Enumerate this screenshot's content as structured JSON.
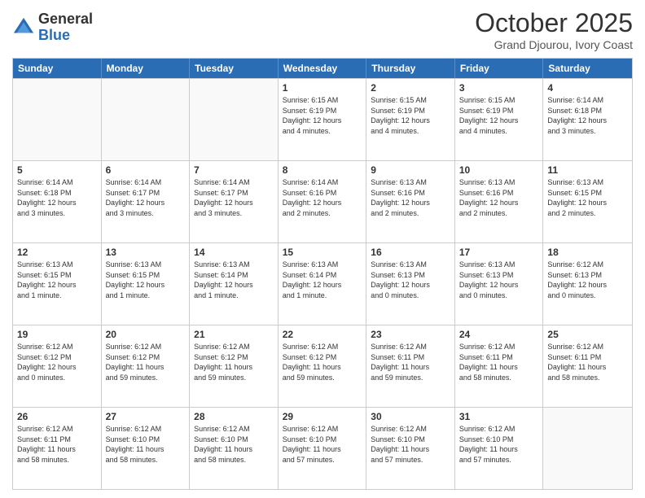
{
  "header": {
    "logo": {
      "general": "General",
      "blue": "Blue"
    },
    "title": "October 2025",
    "subtitle": "Grand Djourou, Ivory Coast"
  },
  "calendar": {
    "days": [
      "Sunday",
      "Monday",
      "Tuesday",
      "Wednesday",
      "Thursday",
      "Friday",
      "Saturday"
    ],
    "rows": [
      [
        {
          "date": "",
          "info": ""
        },
        {
          "date": "",
          "info": ""
        },
        {
          "date": "",
          "info": ""
        },
        {
          "date": "1",
          "info": "Sunrise: 6:15 AM\nSunset: 6:19 PM\nDaylight: 12 hours\nand 4 minutes."
        },
        {
          "date": "2",
          "info": "Sunrise: 6:15 AM\nSunset: 6:19 PM\nDaylight: 12 hours\nand 4 minutes."
        },
        {
          "date": "3",
          "info": "Sunrise: 6:15 AM\nSunset: 6:19 PM\nDaylight: 12 hours\nand 4 minutes."
        },
        {
          "date": "4",
          "info": "Sunrise: 6:14 AM\nSunset: 6:18 PM\nDaylight: 12 hours\nand 3 minutes."
        }
      ],
      [
        {
          "date": "5",
          "info": "Sunrise: 6:14 AM\nSunset: 6:18 PM\nDaylight: 12 hours\nand 3 minutes."
        },
        {
          "date": "6",
          "info": "Sunrise: 6:14 AM\nSunset: 6:17 PM\nDaylight: 12 hours\nand 3 minutes."
        },
        {
          "date": "7",
          "info": "Sunrise: 6:14 AM\nSunset: 6:17 PM\nDaylight: 12 hours\nand 3 minutes."
        },
        {
          "date": "8",
          "info": "Sunrise: 6:14 AM\nSunset: 6:16 PM\nDaylight: 12 hours\nand 2 minutes."
        },
        {
          "date": "9",
          "info": "Sunrise: 6:13 AM\nSunset: 6:16 PM\nDaylight: 12 hours\nand 2 minutes."
        },
        {
          "date": "10",
          "info": "Sunrise: 6:13 AM\nSunset: 6:16 PM\nDaylight: 12 hours\nand 2 minutes."
        },
        {
          "date": "11",
          "info": "Sunrise: 6:13 AM\nSunset: 6:15 PM\nDaylight: 12 hours\nand 2 minutes."
        }
      ],
      [
        {
          "date": "12",
          "info": "Sunrise: 6:13 AM\nSunset: 6:15 PM\nDaylight: 12 hours\nand 1 minute."
        },
        {
          "date": "13",
          "info": "Sunrise: 6:13 AM\nSunset: 6:15 PM\nDaylight: 12 hours\nand 1 minute."
        },
        {
          "date": "14",
          "info": "Sunrise: 6:13 AM\nSunset: 6:14 PM\nDaylight: 12 hours\nand 1 minute."
        },
        {
          "date": "15",
          "info": "Sunrise: 6:13 AM\nSunset: 6:14 PM\nDaylight: 12 hours\nand 1 minute."
        },
        {
          "date": "16",
          "info": "Sunrise: 6:13 AM\nSunset: 6:13 PM\nDaylight: 12 hours\nand 0 minutes."
        },
        {
          "date": "17",
          "info": "Sunrise: 6:13 AM\nSunset: 6:13 PM\nDaylight: 12 hours\nand 0 minutes."
        },
        {
          "date": "18",
          "info": "Sunrise: 6:12 AM\nSunset: 6:13 PM\nDaylight: 12 hours\nand 0 minutes."
        }
      ],
      [
        {
          "date": "19",
          "info": "Sunrise: 6:12 AM\nSunset: 6:12 PM\nDaylight: 12 hours\nand 0 minutes."
        },
        {
          "date": "20",
          "info": "Sunrise: 6:12 AM\nSunset: 6:12 PM\nDaylight: 11 hours\nand 59 minutes."
        },
        {
          "date": "21",
          "info": "Sunrise: 6:12 AM\nSunset: 6:12 PM\nDaylight: 11 hours\nand 59 minutes."
        },
        {
          "date": "22",
          "info": "Sunrise: 6:12 AM\nSunset: 6:12 PM\nDaylight: 11 hours\nand 59 minutes."
        },
        {
          "date": "23",
          "info": "Sunrise: 6:12 AM\nSunset: 6:11 PM\nDaylight: 11 hours\nand 59 minutes."
        },
        {
          "date": "24",
          "info": "Sunrise: 6:12 AM\nSunset: 6:11 PM\nDaylight: 11 hours\nand 58 minutes."
        },
        {
          "date": "25",
          "info": "Sunrise: 6:12 AM\nSunset: 6:11 PM\nDaylight: 11 hours\nand 58 minutes."
        }
      ],
      [
        {
          "date": "26",
          "info": "Sunrise: 6:12 AM\nSunset: 6:11 PM\nDaylight: 11 hours\nand 58 minutes."
        },
        {
          "date": "27",
          "info": "Sunrise: 6:12 AM\nSunset: 6:10 PM\nDaylight: 11 hours\nand 58 minutes."
        },
        {
          "date": "28",
          "info": "Sunrise: 6:12 AM\nSunset: 6:10 PM\nDaylight: 11 hours\nand 58 minutes."
        },
        {
          "date": "29",
          "info": "Sunrise: 6:12 AM\nSunset: 6:10 PM\nDaylight: 11 hours\nand 57 minutes."
        },
        {
          "date": "30",
          "info": "Sunrise: 6:12 AM\nSunset: 6:10 PM\nDaylight: 11 hours\nand 57 minutes."
        },
        {
          "date": "31",
          "info": "Sunrise: 6:12 AM\nSunset: 6:10 PM\nDaylight: 11 hours\nand 57 minutes."
        },
        {
          "date": "",
          "info": ""
        }
      ]
    ]
  }
}
